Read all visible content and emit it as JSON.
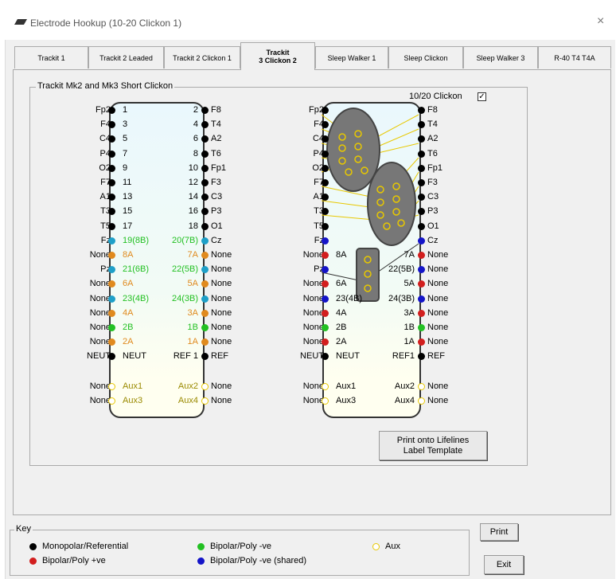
{
  "window": {
    "title": "Electrode Hookup (10-20 Clickon 1)",
    "close": "×"
  },
  "tabs": [
    "Trackit 1",
    "Trackit 2 Leaded",
    "Trackit 2 Clickon 1",
    "Trackit\n3 Clickon 2",
    "Sleep Walker 1",
    "Sleep Clickon",
    "Sleep Walker 3",
    "R-40 T4 T4A"
  ],
  "active_tab": 3,
  "group_title": "Trackit Mk2 and Mk3 Short Clickon",
  "clickon_label": "10/20 Clickon",
  "clickon_checked": "✓",
  "colors": {
    "black": "#000000",
    "red": "#d21e1e",
    "green": "#22c022",
    "blue": "#1414c8",
    "cyan": "#1ea0c8",
    "orange": "#e08a1e",
    "yellow": "#e8c800"
  },
  "left_connector": {
    "rows": [
      {
        "ln": "Fp2",
        "lp": "1",
        "rp": "2",
        "rn": "F8",
        "lc": "black",
        "rc": "black",
        "pc": "black"
      },
      {
        "ln": "F4",
        "lp": "3",
        "rp": "4",
        "rn": "T4",
        "lc": "black",
        "rc": "black",
        "pc": "black"
      },
      {
        "ln": "C4",
        "lp": "5",
        "rp": "6",
        "rn": "A2",
        "lc": "black",
        "rc": "black",
        "pc": "black"
      },
      {
        "ln": "P4",
        "lp": "7",
        "rp": "8",
        "rn": "T6",
        "lc": "black",
        "rc": "black",
        "pc": "black"
      },
      {
        "ln": "O2",
        "lp": "9",
        "rp": "10",
        "rn": "Fp1",
        "lc": "black",
        "rc": "black",
        "pc": "black"
      },
      {
        "ln": "F7",
        "lp": "11",
        "rp": "12",
        "rn": "F3",
        "lc": "black",
        "rc": "black",
        "pc": "black"
      },
      {
        "ln": "A1",
        "lp": "13",
        "rp": "14",
        "rn": "C3",
        "lc": "black",
        "rc": "black",
        "pc": "black"
      },
      {
        "ln": "T3",
        "lp": "15",
        "rp": "16",
        "rn": "P3",
        "lc": "black",
        "rc": "black",
        "pc": "black"
      },
      {
        "ln": "T5",
        "lp": "17",
        "rp": "18",
        "rn": "O1",
        "lc": "black",
        "rc": "black",
        "pc": "black"
      },
      {
        "ln": "Fz",
        "lp": "19(8B)",
        "rp": "20(7B)",
        "rn": "Cz",
        "lc": "cyan",
        "rc": "cyan",
        "pc": "green"
      },
      {
        "ln": "None",
        "lp": "8A",
        "rp": "7A",
        "rn": "None",
        "lc": "orange",
        "rc": "orange",
        "pc": "orange"
      },
      {
        "ln": "Pz",
        "lp": "21(6B)",
        "rp": "22(5B)",
        "rn": "None",
        "lc": "cyan",
        "rc": "cyan",
        "pc": "green"
      },
      {
        "ln": "None",
        "lp": "6A",
        "rp": "5A",
        "rn": "None",
        "lc": "orange",
        "rc": "orange",
        "pc": "orange"
      },
      {
        "ln": "None",
        "lp": "23(4B)",
        "rp": "24(3B)",
        "rn": "None",
        "lc": "cyan",
        "rc": "cyan",
        "pc": "green"
      },
      {
        "ln": "None",
        "lp": "4A",
        "rp": "3A",
        "rn": "None",
        "lc": "orange",
        "rc": "orange",
        "pc": "orange"
      },
      {
        "ln": "None",
        "lp": "2B",
        "rp": "1B",
        "rn": "None",
        "lc": "green",
        "rc": "green",
        "pc": "green"
      },
      {
        "ln": "None",
        "lp": "2A",
        "rp": "1A",
        "rn": "None",
        "lc": "orange",
        "rc": "orange",
        "pc": "orange"
      },
      {
        "ln": "NEUT",
        "lp": "NEUT",
        "rp": "REF 1",
        "rn": "REF",
        "lc": "black",
        "rc": "black",
        "pc": "black"
      }
    ],
    "aux": [
      {
        "ln": "None",
        "lp": "Aux1",
        "rp": "Aux2",
        "rn": "None"
      },
      {
        "ln": "None",
        "lp": "Aux3",
        "rp": "Aux4",
        "rn": "None"
      }
    ]
  },
  "right_connector": {
    "rows": [
      {
        "ln": "Fp2",
        "lp": "",
        "rp": "",
        "rn": "F8",
        "lc": "black",
        "rc": "black"
      },
      {
        "ln": "F4",
        "lp": "",
        "rp": "",
        "rn": "T4",
        "lc": "black",
        "rc": "black"
      },
      {
        "ln": "C4",
        "lp": "",
        "rp": "",
        "rn": "A2",
        "lc": "black",
        "rc": "black"
      },
      {
        "ln": "P4",
        "lp": "",
        "rp": "",
        "rn": "T6",
        "lc": "black",
        "rc": "black"
      },
      {
        "ln": "O2",
        "lp": "",
        "rp": "",
        "rn": "Fp1",
        "lc": "black",
        "rc": "black"
      },
      {
        "ln": "F7",
        "lp": "",
        "rp": "",
        "rn": "F3",
        "lc": "black",
        "rc": "black"
      },
      {
        "ln": "A1",
        "lp": "",
        "rp": "",
        "rn": "C3",
        "lc": "black",
        "rc": "black"
      },
      {
        "ln": "T3",
        "lp": "",
        "rp": "",
        "rn": "P3",
        "lc": "black",
        "rc": "black"
      },
      {
        "ln": "T5",
        "lp": "",
        "rp": "",
        "rn": "O1",
        "lc": "black",
        "rc": "black"
      },
      {
        "ln": "Fz",
        "lp": "",
        "rp": "",
        "rn": "Cz",
        "lc": "blue",
        "rc": "blue"
      },
      {
        "ln": "None",
        "lp": "8A",
        "rp": "7A",
        "rn": "None",
        "lc": "red",
        "rc": "red"
      },
      {
        "ln": "Pz",
        "lp": "",
        "rp": "22(5B)",
        "rn": "None",
        "lc": "blue",
        "rc": "blue"
      },
      {
        "ln": "None",
        "lp": "6A",
        "rp": "5A",
        "rn": "None",
        "lc": "red",
        "rc": "red"
      },
      {
        "ln": "None",
        "lp": "23(4B)",
        "rp": "24(3B)",
        "rn": "None",
        "lc": "blue",
        "rc": "blue"
      },
      {
        "ln": "None",
        "lp": "4A",
        "rp": "3A",
        "rn": "None",
        "lc": "red",
        "rc": "red"
      },
      {
        "ln": "None",
        "lp": "2B",
        "rp": "1B",
        "rn": "None",
        "lc": "green",
        "rc": "green"
      },
      {
        "ln": "None",
        "lp": "2A",
        "rp": "1A",
        "rn": "None",
        "lc": "red",
        "rc": "red"
      },
      {
        "ln": "NEUT",
        "lp": "NEUT",
        "rp": "REF1",
        "rn": "REF",
        "lc": "black",
        "rc": "black"
      }
    ],
    "aux": [
      {
        "ln": "None",
        "lp": "Aux1",
        "rp": "Aux2",
        "rn": "None"
      },
      {
        "ln": "None",
        "lp": "Aux3",
        "rp": "Aux4",
        "rn": "None"
      }
    ]
  },
  "print_template_button": "Print onto Lifelines\nLabel Template",
  "key": {
    "title": "Key",
    "items": [
      {
        "label": "Monopolar/Referential",
        "color": "black"
      },
      {
        "label": "Bipolar/Poly +ve",
        "color": "red"
      },
      {
        "label": "Bipolar/Poly -ve",
        "color": "green"
      },
      {
        "label": "Bipolar/Poly -ve (shared)",
        "color": "blue"
      },
      {
        "label": "Aux",
        "color": "yellow"
      }
    ]
  },
  "buttons": {
    "print": "Print",
    "exit": "Exit"
  }
}
